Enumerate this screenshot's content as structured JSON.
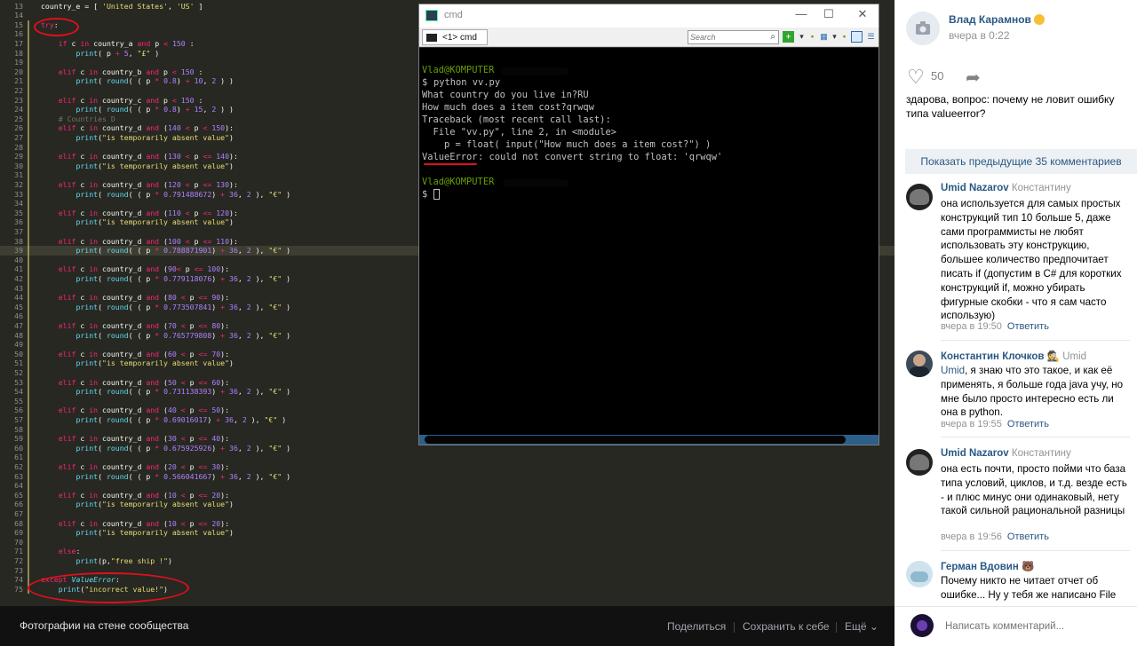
{
  "editor": {
    "lines": [
      {
        "n": "13",
        "hl": false,
        "mark": false,
        "h": "country_e = [ <span class=\"str\">'United States'</span>, <span class=\"str\">'US'</span> ]"
      },
      {
        "n": "14",
        "hl": false,
        "mark": false,
        "h": ""
      },
      {
        "n": "15",
        "hl": false,
        "mark": true,
        "h": "<span class=\"kw\">try</span>:"
      },
      {
        "n": "16",
        "hl": false,
        "mark": true,
        "h": ""
      },
      {
        "n": "17",
        "hl": false,
        "mark": true,
        "h": "    <span class=\"kw\">if</span> c <span class=\"kw\">in</span> country_a <span class=\"kw\">and</span> p <span class=\"kw\">&lt;</span> <span class=\"num\">150</span> :"
      },
      {
        "n": "18",
        "hl": false,
        "mark": true,
        "h": "        <span class=\"fn\">print</span>( p <span class=\"kw\">+</span> <span class=\"num\">5</span>, <span class=\"str\">\"£\"</span> )"
      },
      {
        "n": "19",
        "hl": false,
        "mark": true,
        "h": ""
      },
      {
        "n": "20",
        "hl": false,
        "mark": true,
        "h": "    <span class=\"kw\">elif</span> c <span class=\"kw\">in</span> country_b <span class=\"kw\">and</span> p <span class=\"kw\">&lt;</span> <span class=\"num\">150</span> :"
      },
      {
        "n": "21",
        "hl": false,
        "mark": true,
        "h": "        <span class=\"fn\">print</span>( <span class=\"fn\">round</span>( ( p <span class=\"kw\">*</span> <span class=\"num\">0.8</span>) <span class=\"kw\">+</span> <span class=\"num\">10</span>, <span class=\"num\">2</span> ) )"
      },
      {
        "n": "22",
        "hl": false,
        "mark": true,
        "h": ""
      },
      {
        "n": "23",
        "hl": false,
        "mark": true,
        "h": "    <span class=\"kw\">elif</span> c <span class=\"kw\">in</span> country_c <span class=\"kw\">and</span> p <span class=\"kw\">&lt;</span> <span class=\"num\">150</span> :"
      },
      {
        "n": "24",
        "hl": false,
        "mark": true,
        "h": "        <span class=\"fn\">print</span>( <span class=\"fn\">round</span>( ( p <span class=\"kw\">*</span> <span class=\"num\">0.8</span>) <span class=\"kw\">+</span> <span class=\"num\">15</span>, <span class=\"num\">2</span> ) )"
      },
      {
        "n": "25",
        "hl": false,
        "mark": true,
        "h": "    <span class=\"cm\"># Countries D</span>"
      },
      {
        "n": "26",
        "hl": false,
        "mark": true,
        "h": "    <span class=\"kw\">elif</span> c <span class=\"kw\">in</span> country_d <span class=\"kw\">and</span> (<span class=\"num\">140</span> <span class=\"kw\">&lt;</span> p <span class=\"kw\">&lt;</span> <span class=\"num\">150</span>):"
      },
      {
        "n": "27",
        "hl": false,
        "mark": true,
        "h": "        <span class=\"fn\">print</span>(<span class=\"str\">\"is temporarily absent value\"</span>)"
      },
      {
        "n": "28",
        "hl": false,
        "mark": true,
        "h": ""
      },
      {
        "n": "29",
        "hl": false,
        "mark": true,
        "h": "    <span class=\"kw\">elif</span> c <span class=\"kw\">in</span> country_d <span class=\"kw\">and</span> (<span class=\"num\">130</span> <span class=\"kw\">&lt;</span> p <span class=\"kw\">&lt;=</span> <span class=\"num\">140</span>):"
      },
      {
        "n": "30",
        "hl": false,
        "mark": true,
        "h": "        <span class=\"fn\">print</span>(<span class=\"str\">\"is temporarily absent value\"</span>)"
      },
      {
        "n": "31",
        "hl": false,
        "mark": true,
        "h": ""
      },
      {
        "n": "32",
        "hl": false,
        "mark": true,
        "h": "    <span class=\"kw\">elif</span> c <span class=\"kw\">in</span> country_d <span class=\"kw\">and</span> (<span class=\"num\">120</span> <span class=\"kw\">&lt;</span> p <span class=\"kw\">&lt;=</span> <span class=\"num\">130</span>):"
      },
      {
        "n": "33",
        "hl": false,
        "mark": true,
        "h": "        <span class=\"fn\">print</span>( <span class=\"fn\">round</span>( ( p <span class=\"kw\">*</span> <span class=\"num\">0.791488672</span>) <span class=\"kw\">+</span> <span class=\"num\">36</span>, <span class=\"num\">2</span> ), <span class=\"str\">\"€\"</span> )"
      },
      {
        "n": "34",
        "hl": false,
        "mark": true,
        "h": ""
      },
      {
        "n": "35",
        "hl": false,
        "mark": true,
        "h": "    <span class=\"kw\">elif</span> c <span class=\"kw\">in</span> country_d <span class=\"kw\">and</span> (<span class=\"num\">110</span> <span class=\"kw\">&lt;</span> p <span class=\"kw\">&lt;=</span> <span class=\"num\">120</span>):"
      },
      {
        "n": "36",
        "hl": false,
        "mark": true,
        "h": "        <span class=\"fn\">print</span>(<span class=\"str\">\"is temporarily absent value\"</span>)"
      },
      {
        "n": "37",
        "hl": false,
        "mark": true,
        "h": ""
      },
      {
        "n": "38",
        "hl": false,
        "mark": true,
        "h": "    <span class=\"kw\">elif</span> c <span class=\"kw\">in</span> country_d <span class=\"kw\">and</span> (<span class=\"num\">100</span> <span class=\"kw\">&lt;</span> p <span class=\"kw\">&lt;=</span> <span class=\"num\">110</span>):"
      },
      {
        "n": "39",
        "hl": true,
        "mark": true,
        "h": "        <span class=\"fn\">print</span>( <span class=\"fn\">round</span>( ( p <span class=\"kw\">*</span> <span class=\"num\">0.788871901</span>) <span class=\"kw\">+</span> <span class=\"num\">36</span>, <span class=\"num\">2</span> ), <span class=\"str\">\"€\"</span> )"
      },
      {
        "n": "40",
        "hl": false,
        "mark": true,
        "h": ""
      },
      {
        "n": "41",
        "hl": false,
        "mark": true,
        "h": "    <span class=\"kw\">elif</span> c <span class=\"kw\">in</span> country_d <span class=\"kw\">and</span> (<span class=\"num\">90</span><span class=\"kw\">&lt;</span> p <span class=\"kw\">&lt;=</span> <span class=\"num\">100</span>):"
      },
      {
        "n": "42",
        "hl": false,
        "mark": true,
        "h": "        <span class=\"fn\">print</span>( <span class=\"fn\">round</span>( ( p <span class=\"kw\">*</span> <span class=\"num\">0.779118076</span>) <span class=\"kw\">+</span> <span class=\"num\">36</span>, <span class=\"num\">2</span> ), <span class=\"str\">\"€\"</span> )"
      },
      {
        "n": "43",
        "hl": false,
        "mark": true,
        "h": ""
      },
      {
        "n": "44",
        "hl": false,
        "mark": true,
        "h": "    <span class=\"kw\">elif</span> c <span class=\"kw\">in</span> country_d <span class=\"kw\">and</span> (<span class=\"num\">80</span> <span class=\"kw\">&lt;</span> p <span class=\"kw\">&lt;=</span> <span class=\"num\">90</span>):"
      },
      {
        "n": "45",
        "hl": false,
        "mark": true,
        "h": "        <span class=\"fn\">print</span>( <span class=\"fn\">round</span>( ( p <span class=\"kw\">*</span> <span class=\"num\">0.773507841</span>) <span class=\"kw\">+</span> <span class=\"num\">36</span>, <span class=\"num\">2</span> ), <span class=\"str\">\"€\"</span> )"
      },
      {
        "n": "46",
        "hl": false,
        "mark": true,
        "h": ""
      },
      {
        "n": "47",
        "hl": false,
        "mark": true,
        "h": "    <span class=\"kw\">elif</span> c <span class=\"kw\">in</span> country_d <span class=\"kw\">and</span> (<span class=\"num\">70</span> <span class=\"kw\">&lt;</span> p <span class=\"kw\">&lt;=</span> <span class=\"num\">80</span>):"
      },
      {
        "n": "48",
        "hl": false,
        "mark": true,
        "h": "        <span class=\"fn\">print</span>( <span class=\"fn\">round</span>( ( p <span class=\"kw\">*</span> <span class=\"num\">0.765779808</span>) <span class=\"kw\">+</span> <span class=\"num\">36</span>, <span class=\"num\">2</span> ), <span class=\"str\">\"€\"</span> )"
      },
      {
        "n": "49",
        "hl": false,
        "mark": true,
        "h": ""
      },
      {
        "n": "50",
        "hl": false,
        "mark": true,
        "h": "    <span class=\"kw\">elif</span> c <span class=\"kw\">in</span> country_d <span class=\"kw\">and</span> (<span class=\"num\">60</span> <span class=\"kw\">&lt;</span> p <span class=\"kw\">&lt;=</span> <span class=\"num\">70</span>):"
      },
      {
        "n": "51",
        "hl": false,
        "mark": true,
        "h": "        <span class=\"fn\">print</span>(<span class=\"str\">\"is temporarily absent value\"</span>)"
      },
      {
        "n": "52",
        "hl": false,
        "mark": true,
        "h": ""
      },
      {
        "n": "53",
        "hl": false,
        "mark": true,
        "h": "    <span class=\"kw\">elif</span> c <span class=\"kw\">in</span> country_d <span class=\"kw\">and</span> (<span class=\"num\">50</span> <span class=\"kw\">&lt;</span> p <span class=\"kw\">&lt;=</span> <span class=\"num\">60</span>):"
      },
      {
        "n": "54",
        "hl": false,
        "mark": true,
        "h": "        <span class=\"fn\">print</span>( <span class=\"fn\">round</span>( ( p <span class=\"kw\">*</span> <span class=\"num\">0.731138393</span>) <span class=\"kw\">+</span> <span class=\"num\">36</span>, <span class=\"num\">2</span> ), <span class=\"str\">\"€\"</span> )"
      },
      {
        "n": "55",
        "hl": false,
        "mark": true,
        "h": ""
      },
      {
        "n": "56",
        "hl": false,
        "mark": true,
        "h": "    <span class=\"kw\">elif</span> c <span class=\"kw\">in</span> country_d <span class=\"kw\">and</span> (<span class=\"num\">40</span> <span class=\"kw\">&lt;</span> p <span class=\"kw\">&lt;=</span> <span class=\"num\">50</span>):"
      },
      {
        "n": "57",
        "hl": false,
        "mark": true,
        "h": "        <span class=\"fn\">print</span>( <span class=\"fn\">round</span>( ( p <span class=\"kw\">*</span> <span class=\"num\">0.69016017</span>) <span class=\"kw\">+</span> <span class=\"num\">36</span>, <span class=\"num\">2</span> ), <span class=\"str\">\"€\"</span> )"
      },
      {
        "n": "58",
        "hl": false,
        "mark": true,
        "h": ""
      },
      {
        "n": "59",
        "hl": false,
        "mark": true,
        "h": "    <span class=\"kw\">elif</span> c <span class=\"kw\">in</span> country_d <span class=\"kw\">and</span> (<span class=\"num\">30</span> <span class=\"kw\">&lt;</span> p <span class=\"kw\">&lt;=</span> <span class=\"num\">40</span>):"
      },
      {
        "n": "60",
        "hl": false,
        "mark": true,
        "h": "        <span class=\"fn\">print</span>( <span class=\"fn\">round</span>( ( p <span class=\"kw\">*</span> <span class=\"num\">0.675925926</span>) <span class=\"kw\">+</span> <span class=\"num\">36</span>, <span class=\"num\">2</span> ), <span class=\"str\">\"€\"</span> )"
      },
      {
        "n": "61",
        "hl": false,
        "mark": true,
        "h": ""
      },
      {
        "n": "62",
        "hl": false,
        "mark": true,
        "h": "    <span class=\"kw\">elif</span> c <span class=\"kw\">in</span> country_d <span class=\"kw\">and</span> (<span class=\"num\">20</span> <span class=\"kw\">&lt;</span> p <span class=\"kw\">&lt;=</span> <span class=\"num\">30</span>):"
      },
      {
        "n": "63",
        "hl": false,
        "mark": true,
        "h": "        <span class=\"fn\">print</span>( <span class=\"fn\">round</span>( ( p <span class=\"kw\">*</span> <span class=\"num\">0.566041667</span>) <span class=\"kw\">+</span> <span class=\"num\">36</span>, <span class=\"num\">2</span> ), <span class=\"str\">\"€\"</span> )"
      },
      {
        "n": "64",
        "hl": false,
        "mark": true,
        "h": ""
      },
      {
        "n": "65",
        "hl": false,
        "mark": true,
        "h": "    <span class=\"kw\">elif</span> c <span class=\"kw\">in</span> country_d <span class=\"kw\">and</span> (<span class=\"num\">10</span> <span class=\"kw\">&lt;</span> p <span class=\"kw\">&lt;=</span> <span class=\"num\">20</span>):"
      },
      {
        "n": "66",
        "hl": false,
        "mark": true,
        "h": "        <span class=\"fn\">print</span>(<span class=\"str\">\"is temporarily absent value\"</span>)"
      },
      {
        "n": "67",
        "hl": false,
        "mark": true,
        "h": ""
      },
      {
        "n": "68",
        "hl": false,
        "mark": true,
        "h": "    <span class=\"kw\">elif</span> c <span class=\"kw\">in</span> country_d <span class=\"kw\">and</span> (<span class=\"num\">10</span> <span class=\"kw\">&lt;</span> p <span class=\"kw\">&lt;=</span> <span class=\"num\">20</span>):"
      },
      {
        "n": "69",
        "hl": false,
        "mark": true,
        "h": "        <span class=\"fn\">print</span>(<span class=\"str\">\"is temporarily absent value\"</span>)"
      },
      {
        "n": "70",
        "hl": false,
        "mark": true,
        "h": ""
      },
      {
        "n": "71",
        "hl": false,
        "mark": true,
        "h": "    <span class=\"kw\">else</span>:"
      },
      {
        "n": "72",
        "hl": false,
        "mark": true,
        "h": "        <span class=\"fn\">print</span>(p,<span class=\"str\">\"free ship !\"</span>)"
      },
      {
        "n": "73",
        "hl": false,
        "mark": true,
        "h": ""
      },
      {
        "n": "74",
        "hl": false,
        "mark": true,
        "h": "<span class=\"kw\">except</span> <span class=\"exc\">ValueError</span>:"
      },
      {
        "n": "75",
        "hl": false,
        "mark": true,
        "h": "    <span class=\"fn\">print</span>(<span class=\"str\">\"incorrect value!\"</span>)"
      }
    ]
  },
  "cmd": {
    "title": "cmd",
    "tab_label": "<1> cmd",
    "search_placeholder": "Search",
    "controls": {
      "minimize": "—",
      "maximize": "☐",
      "close": "✕"
    },
    "prompt1_user": "Vlad@KOMPUTER",
    "prompt_symbol": "$",
    "cmd1": "python vv.py",
    "out1": "What country do you live in?RU",
    "out2": "How much does a item cost?qrwqw",
    "tb1": "Traceback (most recent call last):",
    "tb2": "  File \"vv.py\", line 2, in <module>",
    "tb3": "    p = float( input(\"How much does a item cost?\") )",
    "err_name": "ValueError",
    "err_msg": ": could not convert string to float: 'qrwqw'",
    "prompt2_user": "Vlad@KOMPUTER"
  },
  "bottom_bar": {
    "caption": "Фотографии на стене сообщества",
    "share": "Поделиться",
    "save": "Сохранить к себе",
    "more": "Ещё ⌄"
  },
  "panel": {
    "author": "Влад Карамнов",
    "date": "вчера в 0:22",
    "likes": "50",
    "post_text": "здарова, вопрос: почему не ловит ошибку типа valueerror?",
    "show_more": "Показать предыдущие 35 комментариев",
    "reply_label": "Ответить",
    "comments": [
      {
        "author": "Umid Nazarov",
        "to": "Константину",
        "text": "она используется для самых простых конструкций тип 10 больше 5, даже сами программисты не любят использовать эту конструкцию, большее количество предпочитает писать if (допустим в C# для коротких конструкций if, можно убирать фигурные скобки - что я сам часто использую)",
        "date": "вчера в 19:50"
      },
      {
        "author": "Константин Клочков",
        "to": "Umid",
        "text_name": "Umid",
        "text": ", я знаю что это такое, и как её применять, я больше года java учу, но мне было просто интересно есть ли она в python.",
        "date": "вчера в 19:55"
      },
      {
        "author": "Umid Nazarov",
        "to": "Константину",
        "text": "она есть почти, просто пойми что база типа условий, циклов, и т.д. везде есть - и плюс минус они одинаковый, нету такой сильной рациональной разницы",
        "date": "вчера в 19:56"
      },
      {
        "author": "Герман Вдовин",
        "to": "",
        "text": "Почему никто не читает отчет об ошибке... Ну у тебя же написано File",
        "date": ""
      }
    ],
    "reply_placeholder": "Написать комментарий..."
  },
  "colors": {
    "editor_bg": "#272822",
    "vk_link": "#2a5885",
    "annotation_red": "#e0101a"
  }
}
